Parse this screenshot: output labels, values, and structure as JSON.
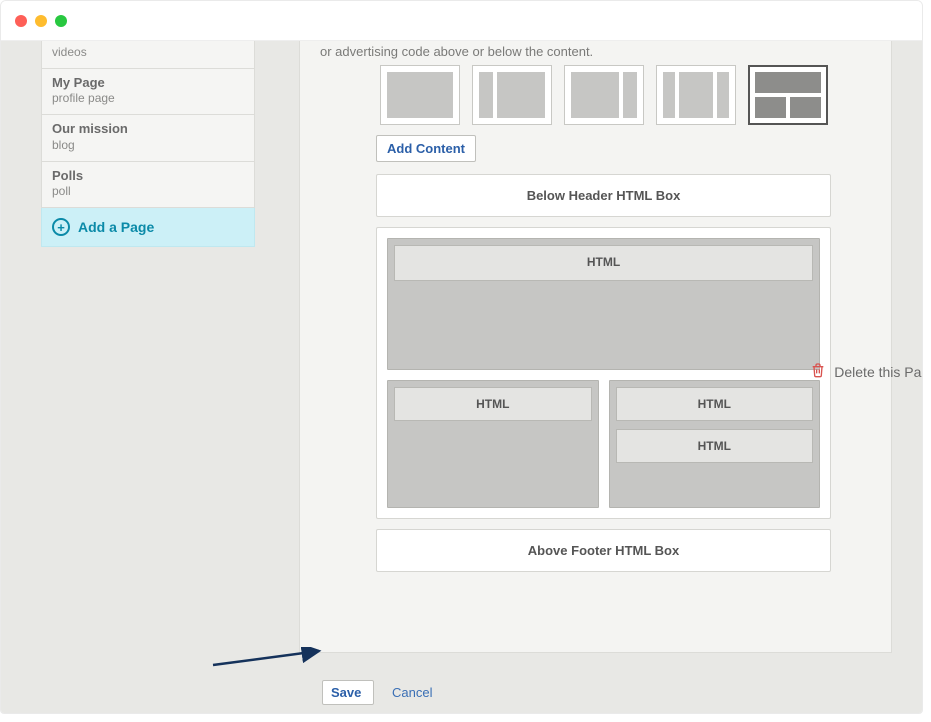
{
  "sidebar": {
    "items": [
      {
        "title": "",
        "subtitle": "videos"
      },
      {
        "title": "My Page",
        "subtitle": "profile page"
      },
      {
        "title": "Our mission",
        "subtitle": "blog"
      },
      {
        "title": "Polls",
        "subtitle": "poll"
      }
    ],
    "add_page_label": "Add a Page"
  },
  "main": {
    "blurb": "or advertising code above or below the content.",
    "add_content_label": "Add Content",
    "below_header_box": "Below Header HTML Box",
    "above_footer_box": "Above Footer HTML Box",
    "html_label": "HTML",
    "layout_templates": [
      "single",
      "two-col-left",
      "two-col-right",
      "three-col",
      "stacked"
    ],
    "active_template_index": 4
  },
  "actions": {
    "save": "Save",
    "cancel": "Cancel",
    "delete": "Delete this Page"
  }
}
